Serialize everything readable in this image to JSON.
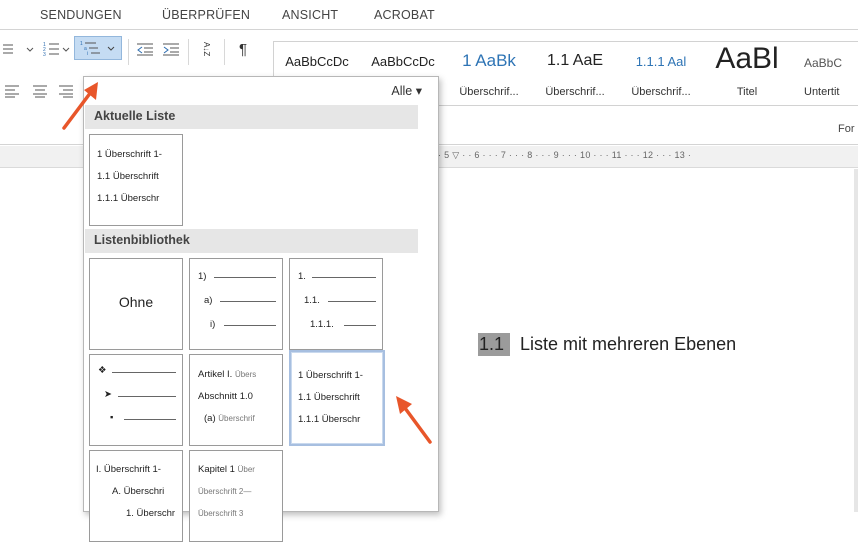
{
  "tabs": [
    "SENDUNGEN",
    "ÜBERPRÜFEN",
    "ANSICHT",
    "ACROBAT"
  ],
  "ribbon": {
    "sort_glyph": "A↓Z",
    "pilcrow": "¶",
    "group_label": "For"
  },
  "styles": [
    {
      "sample": "AaBbCcDc",
      "name": ""
    },
    {
      "sample": "AaBbCcDc",
      "name": "¶"
    },
    {
      "sample": "1 AaBk",
      "name": "Überschrif..."
    },
    {
      "sample": "1.1 AaE",
      "name": "Überschrif..."
    },
    {
      "sample": "1.1.1 Aal",
      "name": "Überschrif..."
    },
    {
      "sample": "AaBl",
      "name": "Titel"
    },
    {
      "sample": "AaBbC",
      "name": "Untertit"
    }
  ],
  "ruler_text": "· 5 ▽ · · 6 · · · 7 · · · 8 · · · 9 · · · 10 · · · 11 · · · 12 · · · 13 ·",
  "panel": {
    "filter_label": "Alle ▾",
    "section_current": "Aktuelle Liste",
    "section_library": "Listenbibliothek",
    "current_tile": [
      "1 Überschrift 1-",
      "1.1 Überschrift",
      "1.1.1 Überschr"
    ],
    "tile_none": "Ohne",
    "tile_paren": [
      "1)",
      "a)",
      "i)"
    ],
    "tile_decimal": [
      "1.",
      "1.1.",
      "1.1.1."
    ],
    "tile_bullets": [
      "❖",
      "➤",
      "▪"
    ],
    "tile_article": [
      {
        "lvl": "Artikel I.",
        "txt": "Übers"
      },
      {
        "lvl": "Abschnitt 1.0",
        "txt": ""
      },
      {
        "lvl": "(a)",
        "txt": "Überschrif"
      }
    ],
    "tile_heading": [
      "1 Überschrift 1-",
      "1.1 Überschrift",
      "1.1.1 Überschr"
    ],
    "tile_roman": [
      "I. Überschrift 1-",
      "A. Überschri",
      "1. Überschr"
    ],
    "tile_chapter": [
      {
        "lvl": "Kapitel 1",
        "txt": "Über"
      },
      {
        "lvl": "",
        "txt": "Überschrift 2—"
      },
      {
        "lvl": "",
        "txt": "Überschrift 3"
      }
    ]
  },
  "document": {
    "heading_number": "1.1",
    "heading_text": "Liste mit mehreren Ebenen"
  },
  "colors": {
    "arrow": "#e8562a",
    "active_button": "#c5dcf3",
    "selection": "#9b9b9b"
  }
}
